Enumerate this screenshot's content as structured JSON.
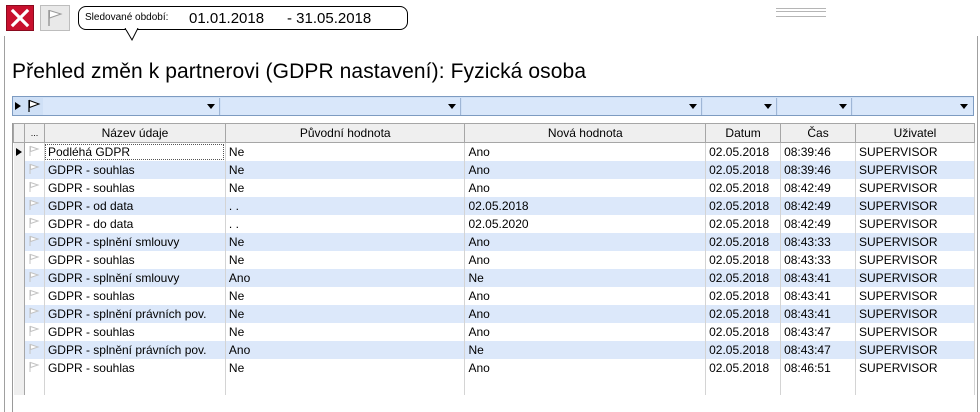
{
  "window": {
    "period_label": "Sledované období:",
    "period_from": "01.01.2018",
    "period_to": "- 31.05.2018"
  },
  "page": {
    "title": "Přehled změn k partnerovi (GDPR nastavení): Fyzická osoba"
  },
  "grid": {
    "marker_header": "...",
    "columns": [
      "Název údaje",
      "Původní hodnota",
      "Nová hodnota",
      "Datum",
      "Čas",
      "Uživatel"
    ],
    "rows": [
      [
        "Podléhá GDPR",
        "Ne",
        "Ano",
        "02.05.2018",
        "08:39:46",
        "SUPERVISOR"
      ],
      [
        "GDPR - souhlas",
        "Ne",
        "Ano",
        "02.05.2018",
        "08:39:46",
        "SUPERVISOR"
      ],
      [
        "GDPR - souhlas",
        "Ne",
        "Ano",
        "02.05.2018",
        "08:42:49",
        "SUPERVISOR"
      ],
      [
        "GDPR - od data",
        " . .",
        "02.05.2018",
        "02.05.2018",
        "08:42:49",
        "SUPERVISOR"
      ],
      [
        "GDPR - do data",
        " . .",
        "02.05.2020",
        "02.05.2018",
        "08:42:49",
        "SUPERVISOR"
      ],
      [
        "GDPR - splnění smlouvy",
        "Ne",
        "Ano",
        "02.05.2018",
        "08:43:33",
        "SUPERVISOR"
      ],
      [
        "GDPR - souhlas",
        "Ne",
        "Ano",
        "02.05.2018",
        "08:43:33",
        "SUPERVISOR"
      ],
      [
        "GDPR - splnění smlouvy",
        "Ano",
        "Ne",
        "02.05.2018",
        "08:43:41",
        "SUPERVISOR"
      ],
      [
        "GDPR - souhlas",
        "Ne",
        "Ano",
        "02.05.2018",
        "08:43:41",
        "SUPERVISOR"
      ],
      [
        "GDPR - splnění právních pov.",
        "Ne",
        "Ano",
        "02.05.2018",
        "08:43:41",
        "SUPERVISOR"
      ],
      [
        "GDPR - souhlas",
        "Ne",
        "Ano",
        "02.05.2018",
        "08:43:47",
        "SUPERVISOR"
      ],
      [
        "GDPR - splnění právních pov.",
        "Ano",
        "Ne",
        "02.05.2018",
        "08:43:47",
        "SUPERVISOR"
      ],
      [
        "GDPR - souhlas",
        "Ne",
        "Ano",
        "02.05.2018",
        "08:46:51",
        "SUPERVISOR"
      ]
    ]
  },
  "colors": {
    "row_even": "#dce8fa",
    "row_odd": "#ffffff",
    "filter_bar": "#cfe0f6",
    "close_red": "#c8102e"
  },
  "icons": {
    "close": "close-icon",
    "flag": "flag-icon",
    "row_pointer": "row-pointer-icon",
    "dropdown": "chevron-down-icon"
  }
}
